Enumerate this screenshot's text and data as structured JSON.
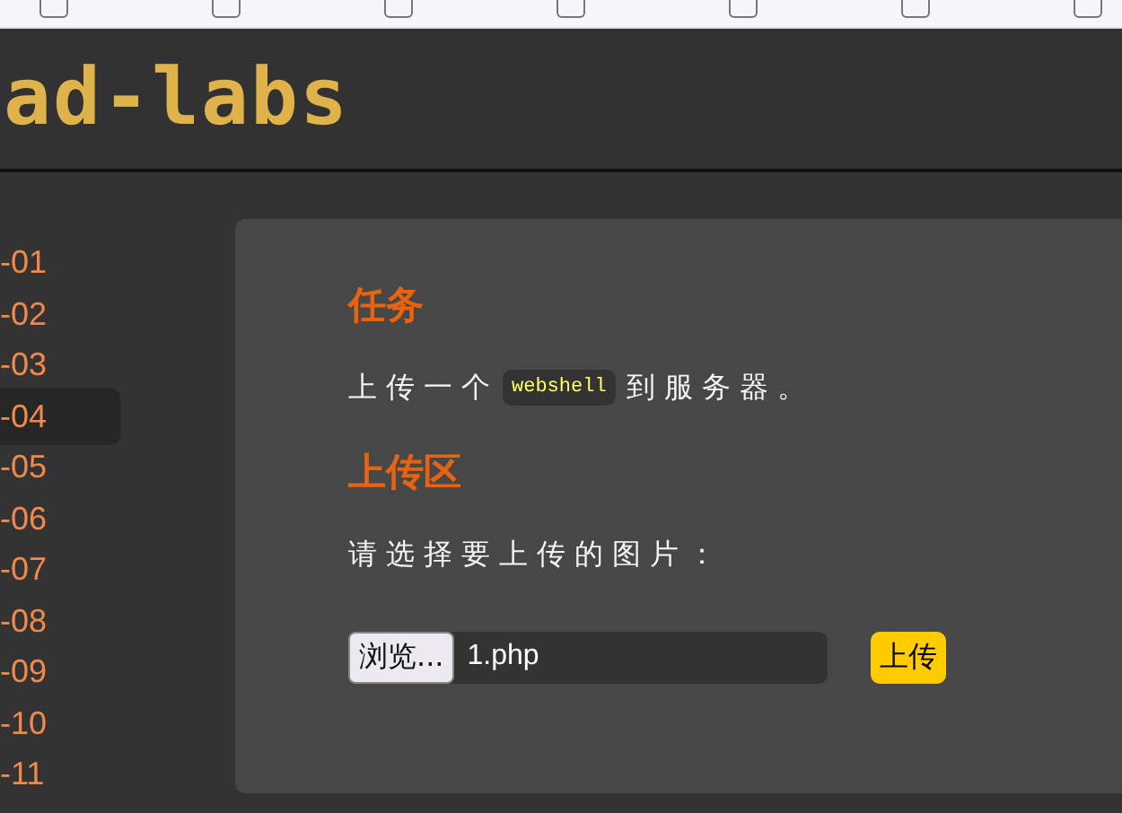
{
  "logo": {
    "text": "ad-labs"
  },
  "sidebar": {
    "items": [
      {
        "label": "-01",
        "selected": false
      },
      {
        "label": "-02",
        "selected": false
      },
      {
        "label": "-03",
        "selected": false
      },
      {
        "label": "-04",
        "selected": true
      },
      {
        "label": "-05",
        "selected": false
      },
      {
        "label": "-06",
        "selected": false
      },
      {
        "label": "-07",
        "selected": false
      },
      {
        "label": "-08",
        "selected": false
      },
      {
        "label": "-09",
        "selected": false
      },
      {
        "label": "-10",
        "selected": false
      },
      {
        "label": "-11",
        "selected": false
      }
    ]
  },
  "task": {
    "heading": "任务",
    "before": "上传一个",
    "code": "webshell",
    "after": "到服务器。"
  },
  "upload": {
    "heading": "上传区",
    "prompt": "请选择要上传的图片：",
    "browse_button": "浏览...",
    "file_name": "1.php",
    "submit_button": "上传"
  }
}
